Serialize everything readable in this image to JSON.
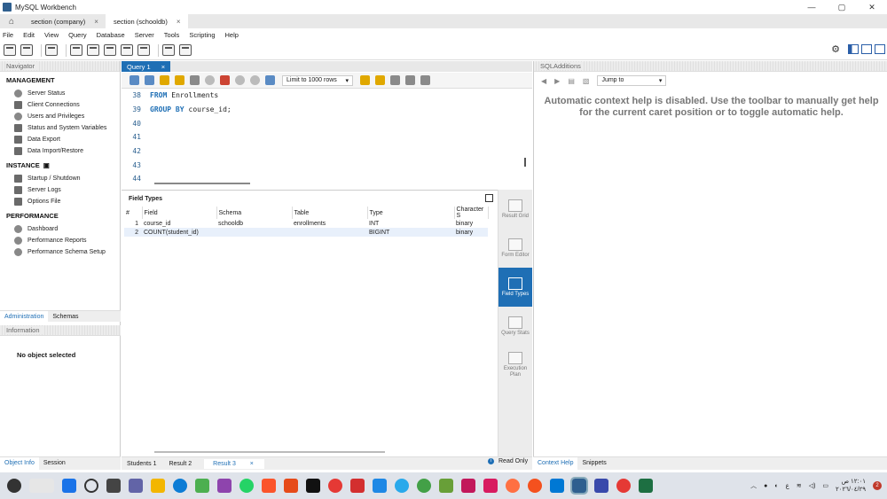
{
  "window": {
    "title": "MySQL Workbench",
    "controls": [
      "—",
      "▢",
      "✕"
    ]
  },
  "connection_tabs": [
    {
      "label": "section  (company)",
      "active": false
    },
    {
      "label": "section  (schooldb)",
      "active": true
    }
  ],
  "menu": [
    "File",
    "Edit",
    "View",
    "Query",
    "Database",
    "Server",
    "Tools",
    "Scripting",
    "Help"
  ],
  "navigator": {
    "title": "Navigator",
    "management_title": "MANAGEMENT",
    "management": [
      "Server Status",
      "Client Connections",
      "Users and Privileges",
      "Status and System Variables",
      "Data Export",
      "Data Import/Restore"
    ],
    "instance_title": "INSTANCE",
    "instance": [
      "Startup / Shutdown",
      "Server Logs",
      "Options File"
    ],
    "performance_title": "PERFORMANCE",
    "performance": [
      "Dashboard",
      "Performance Reports",
      "Performance Schema Setup"
    ],
    "tabs": [
      "Administration",
      "Schemas"
    ],
    "info_title": "Information",
    "no_object": "No object selected",
    "bottom_tabs": [
      "Object Info",
      "Session"
    ]
  },
  "query": {
    "tab_label": "Query 1",
    "limit_label": "Limit to 1000 rows",
    "lines": [
      {
        "num": "38",
        "kw": "FROM",
        "text": "Enrollments"
      },
      {
        "num": "39",
        "kw": "GROUP BY",
        "text": "course_id;"
      },
      {
        "num": "40",
        "kw": "",
        "text": ""
      },
      {
        "num": "41",
        "kw": "",
        "text": ""
      },
      {
        "num": "42",
        "kw": "",
        "text": ""
      },
      {
        "num": "43",
        "kw": "",
        "text": ""
      },
      {
        "num": "44",
        "kw": "",
        "text": ""
      }
    ]
  },
  "results": {
    "title": "Field Types",
    "columns": [
      "#",
      "Field",
      "Schema",
      "Table",
      "Type",
      "Character S"
    ],
    "rows": [
      [
        "1",
        "course_id",
        "schooldb",
        "enrollments",
        "INT",
        "binary"
      ],
      [
        "2",
        "COUNT(student_id)",
        "",
        "",
        "BIGINT",
        "binary"
      ]
    ],
    "side_tabs": [
      {
        "label": "Result Grid",
        "active": false
      },
      {
        "label": "Form Editor",
        "active": false
      },
      {
        "label": "Field Types",
        "active": true
      },
      {
        "label": "Query Stats",
        "active": false
      },
      {
        "label": "Execution Plan",
        "active": false
      }
    ],
    "bottom_tabs": [
      {
        "label": "Students 1",
        "active": false
      },
      {
        "label": "Result 2",
        "active": false
      },
      {
        "label": "Result 3",
        "active": true
      }
    ],
    "read_only": "Read Only"
  },
  "sql_additions": {
    "title": "SQLAdditions",
    "jump_label": "Jump to",
    "help_text": "Automatic context help is disabled. Use the toolbar to manually get help for the current caret position or to toggle automatic help.",
    "bottom_tabs": [
      "Context Help",
      "Snippets"
    ]
  },
  "taskbar": {
    "tray_lang": "ع",
    "time": "١٢:٠١ ص",
    "date": "٢٠٢٦/٠٤/٢٩",
    "notif_count": "2"
  },
  "colors": {
    "accent": "#1f6fb5",
    "keyword": "#1f6fb5"
  }
}
